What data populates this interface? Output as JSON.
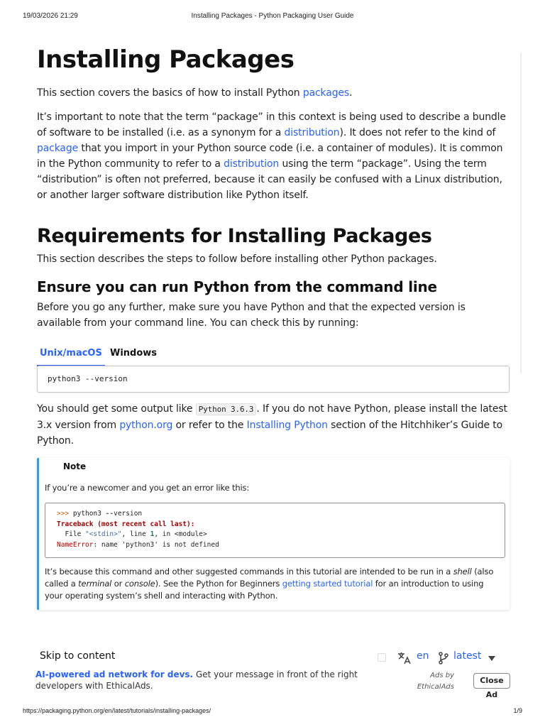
{
  "print_header": {
    "date": "19/03/2026 21:29",
    "title": "Installing Packages - Python Packaging User Guide"
  },
  "intro": {
    "heading": "Installing Packages",
    "p1_text": "This section covers the basics of how to install Python ",
    "p1_link": "packages",
    "p1_end": ".",
    "p2_a": "It’s important to note that the term “package” in this context is being used to describe a bundle of software to be installed (i.e. as a synonym for a ",
    "p2_link1": "distribution",
    "p2_b": "). It does not refer to the kind of ",
    "p2_link2": "package",
    "p2_c": " that you import in your Python source code (i.e. a container of modules). It is common in the Python community to refer to a ",
    "p2_link3": "distribution",
    "p2_d": " using the term “package”. Using the term “distribution” is often not preferred, because it can easily be confused with a Linux distribution, or another larger software distribution like Python itself."
  },
  "requirements": {
    "heading": "Requirements for Installing Packages",
    "text": "This section describes the steps to follow before installing other Python packages."
  },
  "ensure": {
    "heading": "Ensure you can run Python from the command line",
    "text": "Before you go any further, make sure you have Python and that the expected version is available from your command line. You can check this by running:"
  },
  "tabs": [
    {
      "label": "Unix/macOS",
      "active": true
    },
    {
      "label": "Windows",
      "active": false
    }
  ],
  "command": "python3 --version",
  "output_para": {
    "a": "You should get some output like ",
    "code": "Python 3.6.3",
    "b": ". If you do not have Python, please install the latest 3.x version from ",
    "link1": "python.org",
    "c": " or refer to the ",
    "link2": "Installing Python",
    "d": " section of the Hitchhiker’s Guide to Python."
  },
  "note": {
    "title": "Note",
    "p1": "If you’re a newcomer and you get an error like this:",
    "code": {
      "prompt": ">>>",
      "cmd": " python3 ",
      "op": "--",
      "cmd2": "version",
      "traceback": "Traceback (most recent call last):",
      "file_a": "  File ",
      "file_str": "\"<stdin>\"",
      "file_b": ", line ",
      "file_num": "1",
      "file_c": ", in <module>",
      "err_name": "NameError",
      "err_msg": ": name 'python3' is not defined"
    },
    "p2_a": "It’s because this command and other suggested commands in this tutorial are intended to be run in a ",
    "p2_shell": "shell",
    "p2_b": " (also called a ",
    "p2_terminal": "terminal",
    "p2_c": " or ",
    "p2_console": "console",
    "p2_d": "). See the Python for Beginners ",
    "p2_link": "getting started tutorial",
    "p2_e": " for an introduction to using your operating system’s shell and interacting with Python."
  },
  "footer_bar": {
    "skip": "Skip to content",
    "lang": "en",
    "version": "latest"
  },
  "ad": {
    "headline": "AI-powered ad network for devs.",
    "body": " Get your message in front of the right developers with EthicalAds.",
    "ads_by": "Ads by EthicalAds",
    "close": "Close Ad"
  },
  "print_footer": {
    "url": "https://packaging.python.org/en/latest/tutorials/installing-packages/",
    "page": "1/9"
  },
  "colors": {
    "link": "#2962ff",
    "note_border": "#2f9fe3"
  }
}
